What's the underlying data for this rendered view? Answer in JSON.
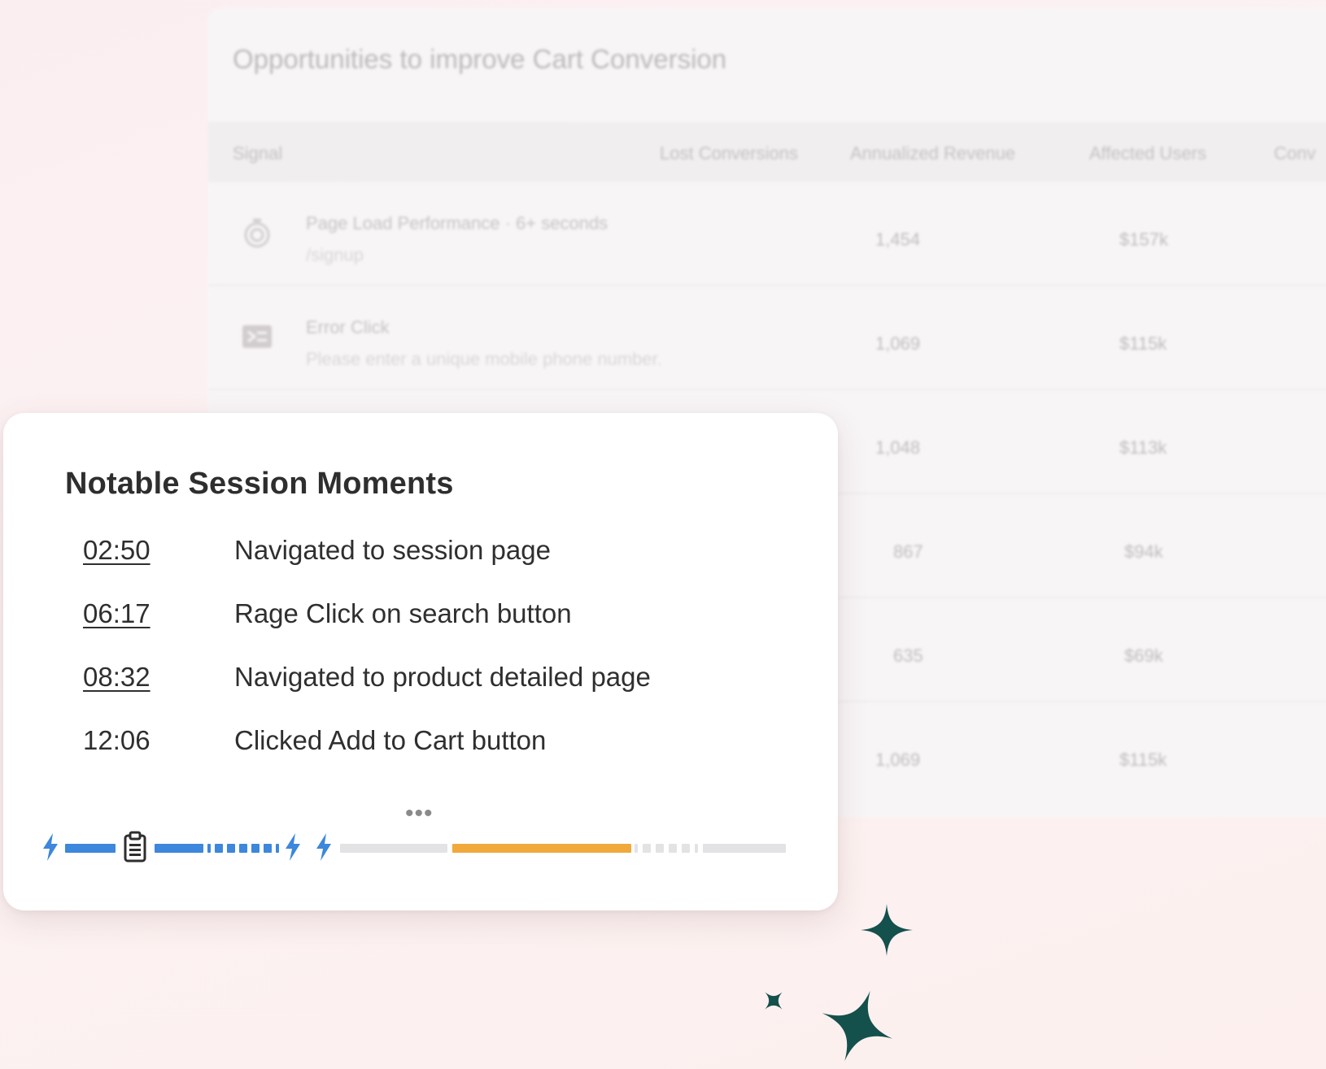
{
  "background_table": {
    "title": "Opportunities to improve Cart Conversion",
    "columns": [
      "Signal",
      "Lost Conversions",
      "Annualized Revenue",
      "Affected Users",
      "Conv"
    ],
    "rows": [
      {
        "icon": "stopwatch-icon",
        "signal": "Page Load Performance · 6+ seconds",
        "detail": "/signup",
        "lost": "1,454",
        "revenue": "$157k",
        "edge": ""
      },
      {
        "icon": "terminal-icon",
        "signal": "Error Click",
        "detail": "Please enter a unique mobile phone number.",
        "lost": "1,069",
        "revenue": "$115k",
        "edge": ""
      },
      {
        "icon": "",
        "signal": "",
        "detail": "",
        "lost": "1,048",
        "revenue": "$113k",
        "edge": ""
      },
      {
        "icon": "",
        "signal": "",
        "detail": "",
        "lost": "867",
        "revenue": "$94k",
        "edge": ""
      },
      {
        "icon": "",
        "signal": "",
        "detail": "",
        "lost": "635",
        "revenue": "$69k",
        "edge": "1"
      },
      {
        "icon": "",
        "signal": "",
        "detail": "",
        "lost": "1,069",
        "revenue": "$115k",
        "edge": ""
      }
    ]
  },
  "card": {
    "title": "Notable Session Moments",
    "moments": [
      {
        "time": "02:50",
        "description": "Navigated to session page",
        "linked": true
      },
      {
        "time": "06:17",
        "description": "Rage Click on search button",
        "linked": true
      },
      {
        "time": "08:32",
        "description": "Navigated to product detailed page",
        "linked": true
      },
      {
        "time": "12:06",
        "description": "Clicked Add to Cart button",
        "linked": false
      }
    ],
    "more_label": "•••"
  },
  "colors": {
    "timeline_blue": "#3d87dc",
    "timeline_orange": "#f0a93a",
    "timeline_gray": "#e3e3e5",
    "sparkle": "#14504c"
  }
}
